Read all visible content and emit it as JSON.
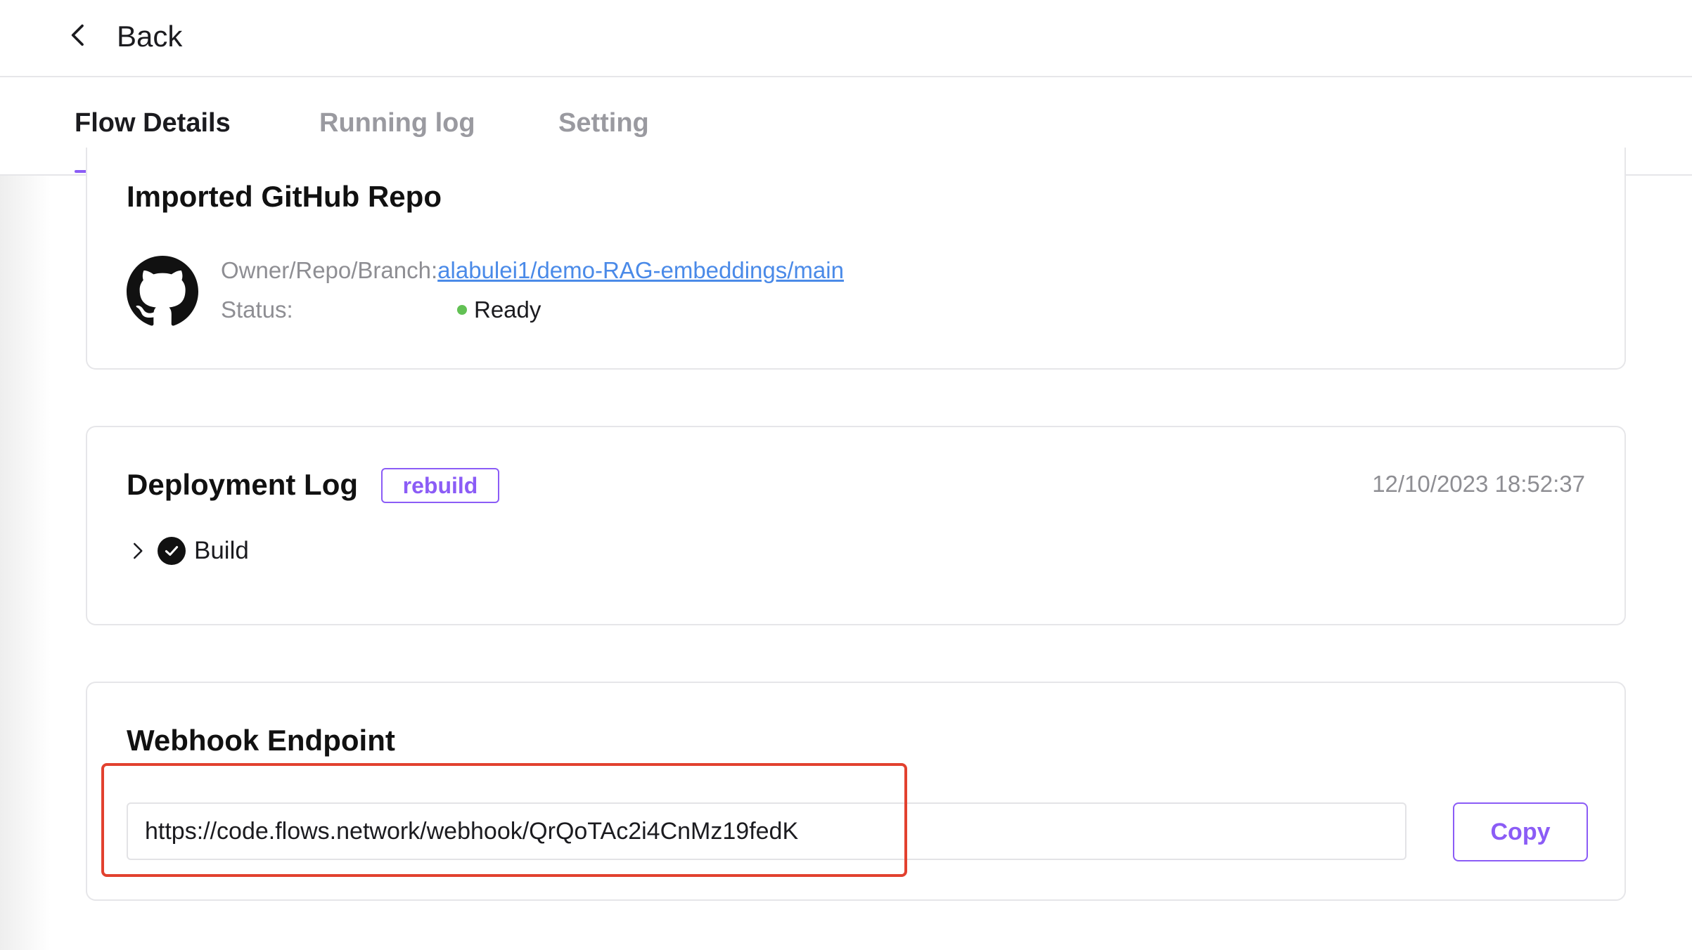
{
  "header": {
    "back_label": "Back"
  },
  "tabs": [
    {
      "label": "Flow Details",
      "active": true
    },
    {
      "label": "Running log",
      "active": false
    },
    {
      "label": "Setting",
      "active": false
    }
  ],
  "repo_card": {
    "title": "Imported GitHub Repo",
    "icon": "github-icon",
    "owner_key": "Owner/Repo/Branch:",
    "owner_value": "alabulei1/demo-RAG-embeddings/main",
    "status_key": "Status:",
    "status_value": "Ready",
    "status_color": "#62c154"
  },
  "deploy_card": {
    "title": "Deployment Log",
    "rebuild_label": "rebuild",
    "timestamp": "12/10/2023 18:52:37",
    "steps": [
      {
        "label": "Build",
        "state": "done"
      }
    ]
  },
  "webhook_card": {
    "title": "Webhook Endpoint",
    "url": "https://code.flows.network/webhook/QrQoTAc2i4CnMz19fedK",
    "copy_label": "Copy"
  },
  "colors": {
    "accent": "#8b5cf6",
    "link": "#4a8ae8",
    "highlight": "#e2412f"
  }
}
